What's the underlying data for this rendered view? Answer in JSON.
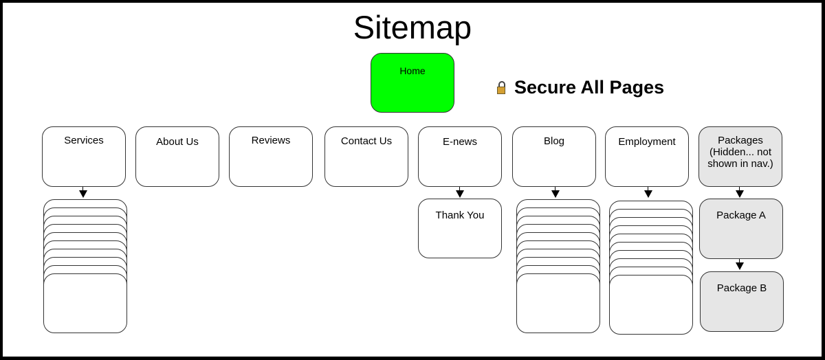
{
  "title": "Sitemap",
  "secure_note": {
    "icon": "lock-icon",
    "text": "Secure All Pages"
  },
  "colors": {
    "home_fill": "#00ff00",
    "hidden_fill": "#e6e6e6",
    "default_fill": "#ffffff",
    "lock_fill": "#d4a033"
  },
  "home": {
    "label": "Home"
  },
  "sections": [
    {
      "label": "Services",
      "children_stack_count": 10
    },
    {
      "label": "About Us"
    },
    {
      "label": "Reviews"
    },
    {
      "label": "Contact Us"
    },
    {
      "label": "E-news",
      "children": [
        "Thank You"
      ]
    },
    {
      "label": "Blog",
      "children_stack_count": 10
    },
    {
      "label": "Employment",
      "children_stack_count": 10
    },
    {
      "label": "Packages (Hidden... not shown in nav.)",
      "hidden": true,
      "children": [
        "Package A",
        "Package B"
      ]
    }
  ],
  "labels": {
    "services": "Services",
    "about": "About Us",
    "reviews": "Reviews",
    "contact": "Contact Us",
    "enews": "E-news",
    "thankyou": "Thank You",
    "blog": "Blog",
    "employment": "Employment",
    "packages_line1": "Packages",
    "packages_line2": "(Hidden... not",
    "packages_line3": "shown in nav.)",
    "package_a": "Package A",
    "package_b": "Package B"
  }
}
